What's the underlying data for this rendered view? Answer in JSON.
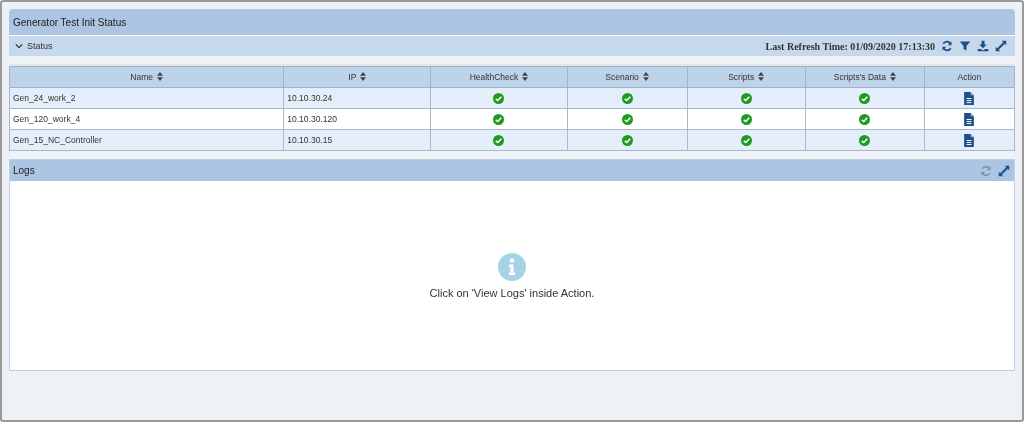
{
  "window": {
    "title": "Generator Test Init Status"
  },
  "status_panel": {
    "title": "Status",
    "expanded": true,
    "last_refresh": "Last Refresh Time: 01/09/2020 17:13:30"
  },
  "table": {
    "columns": [
      {
        "label": "Name",
        "sortable": true
      },
      {
        "label": "IP",
        "sortable": true
      },
      {
        "label": "HealthCheck",
        "sortable": true
      },
      {
        "label": "Scenario",
        "sortable": true
      },
      {
        "label": "Scripts",
        "sortable": true
      },
      {
        "label": "Scripts's Data",
        "sortable": true
      },
      {
        "label": "Action",
        "sortable": false
      }
    ],
    "rows": [
      {
        "name": "Gen_24_work_2",
        "ip": "10.10.30.24",
        "checks": [
          {
            "kind": "passed"
          },
          {
            "kind": "passed"
          },
          {
            "kind": "passed"
          },
          {
            "kind": "passed"
          }
        ],
        "action": {
          "kind": "document"
        }
      },
      {
        "name": "Gen_120_work_4",
        "ip": "10.10.30.120",
        "checks": [
          {
            "kind": "passed"
          },
          {
            "kind": "passed"
          },
          {
            "kind": "passed"
          },
          {
            "kind": "passed"
          }
        ],
        "action": {
          "kind": "document"
        }
      },
      {
        "name": "Gen_15_NC_Controller",
        "ip": "10.10.30.15",
        "checks": [
          {
            "kind": "passed"
          },
          {
            "kind": "passed"
          },
          {
            "kind": "passed"
          },
          {
            "kind": "passed"
          }
        ],
        "action": {
          "kind": "document"
        }
      }
    ]
  },
  "logs": {
    "title": "Logs",
    "refresh_disabled": true,
    "message": "Click on 'View Logs' inside Action."
  }
}
